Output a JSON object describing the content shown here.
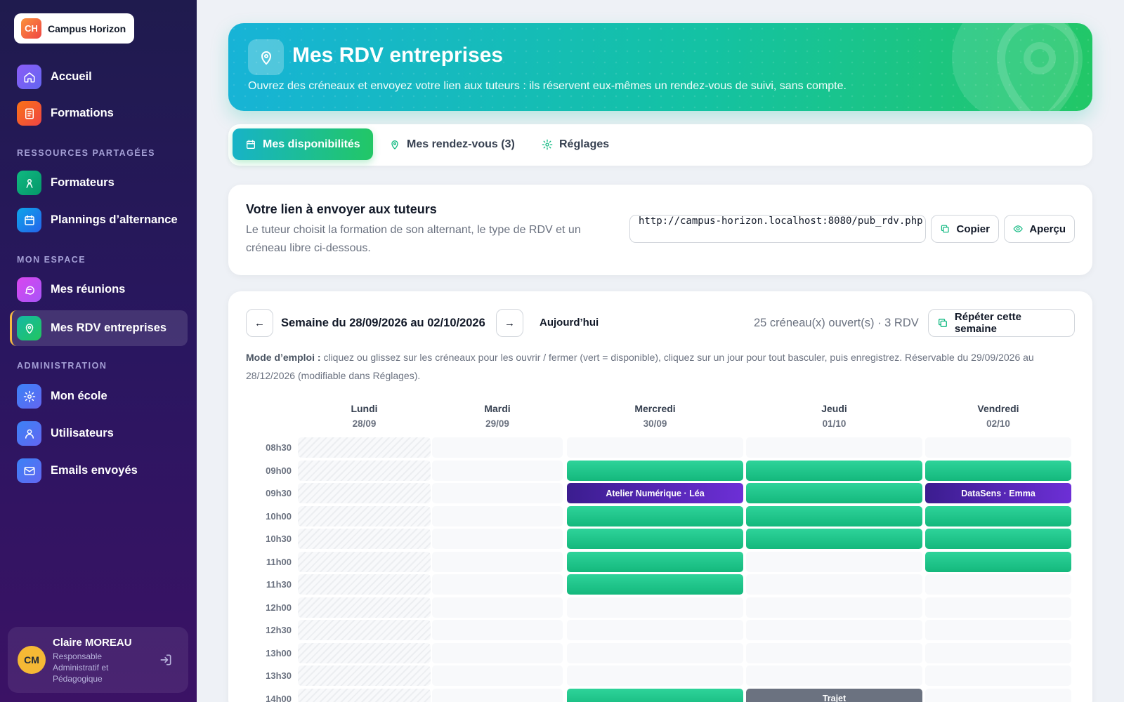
{
  "brand": {
    "logo": "CH",
    "name": "Campus Horizon"
  },
  "sidebar": {
    "top": [
      {
        "label": "Accueil",
        "icon": "home-icon"
      },
      {
        "label": "Formations",
        "icon": "book-icon"
      }
    ],
    "section_shared": "RESSOURCES PARTAGÉES",
    "shared": [
      {
        "label": "Formateurs",
        "icon": "person-icon"
      },
      {
        "label": "Plannings d’alternance",
        "icon": "calendar-icon"
      }
    ],
    "section_mine": "MON ESPACE",
    "mine": [
      {
        "label": "Mes réunions",
        "icon": "chat-icon"
      },
      {
        "label": "Mes RDV entreprises",
        "icon": "map-pin-icon"
      }
    ],
    "section_admin": "ADMINISTRATION",
    "admin": [
      {
        "label": "Mon école",
        "icon": "gear-icon"
      },
      {
        "label": "Utilisateurs",
        "icon": "user-icon"
      },
      {
        "label": "Emails envoyés",
        "icon": "mail-icon"
      }
    ]
  },
  "user": {
    "initials": "CM",
    "name": "Claire MOREAU",
    "role": "Responsable Administratif et Pédagogique"
  },
  "hero": {
    "title": "Mes RDV entreprises",
    "subtitle": "Ouvrez des créneaux et envoyez votre lien aux tuteurs : ils réservent eux-mêmes un rendez-vous de suivi, sans compte."
  },
  "tabs": {
    "dispo": "Mes disponibilités",
    "rdv": "Mes rendez-vous (3)",
    "settings": "Réglages"
  },
  "link_card": {
    "title": "Votre lien à envoyer aux tuteurs",
    "description": "Le tuteur choisit la formation de son alternant, le type de RDV et un créneau libre ci-dessous.",
    "url": "http://campus-horizon.localhost:8080/pub_rdv.php",
    "copy_label": "Copier",
    "preview_label": "Aperçu"
  },
  "planner": {
    "prev": "←",
    "next": "→",
    "week_label": "Semaine du 28/09/2026 au 02/10/2026",
    "today_label": "Aujourd’hui",
    "summary": "25 créneau(x) ouvert(s) · 3 RDV",
    "repeat_label": "Répéter cette semaine",
    "mode_title": "Mode d’emploi :",
    "mode_text": " cliquez ou glissez sur les créneaux pour les ouvrir / fermer (vert = disponible), cliquez sur un jour pour tout basculer, puis enregistrez. Réservable du 29/09/2026 au 28/12/2026 (modifiable dans Réglages).",
    "days": [
      {
        "name": "Lundi",
        "date": "28/09"
      },
      {
        "name": "Mardi",
        "date": "29/09"
      },
      {
        "name": "Mercredi",
        "date": "30/09"
      },
      {
        "name": "Jeudi",
        "date": "01/10"
      },
      {
        "name": "Vendredi",
        "date": "02/10"
      }
    ],
    "times": [
      "08h30",
      "09h00",
      "09h30",
      "10h00",
      "10h30",
      "11h00",
      "11h30",
      "12h00",
      "12h30",
      "13h00",
      "13h30",
      "14h00"
    ],
    "slots": [
      [
        "past",
        "empty",
        "empty",
        "empty",
        "empty"
      ],
      [
        "past",
        "empty",
        "open",
        "open",
        "open"
      ],
      [
        "past",
        "empty",
        "rdv",
        "open",
        "rdv"
      ],
      [
        "past",
        "empty",
        "open",
        "open",
        "open"
      ],
      [
        "past",
        "empty",
        "open",
        "open",
        "open"
      ],
      [
        "past",
        "empty",
        "open",
        "empty",
        "open"
      ],
      [
        "past",
        "empty",
        "open",
        "empty",
        "empty"
      ],
      [
        "past",
        "empty",
        "empty",
        "empty",
        "empty"
      ],
      [
        "past",
        "empty",
        "empty",
        "empty",
        "empty"
      ],
      [
        "past",
        "empty",
        "empty",
        "empty",
        "empty"
      ],
      [
        "past",
        "empty",
        "empty",
        "empty",
        "empty"
      ],
      [
        "past",
        "empty",
        "open",
        "trajet",
        "empty"
      ]
    ],
    "slot_labels": {
      "2-2": "Atelier Numérique · Léa",
      "2-4": "DataSens · Emma",
      "11-3": "Trajet"
    }
  }
}
